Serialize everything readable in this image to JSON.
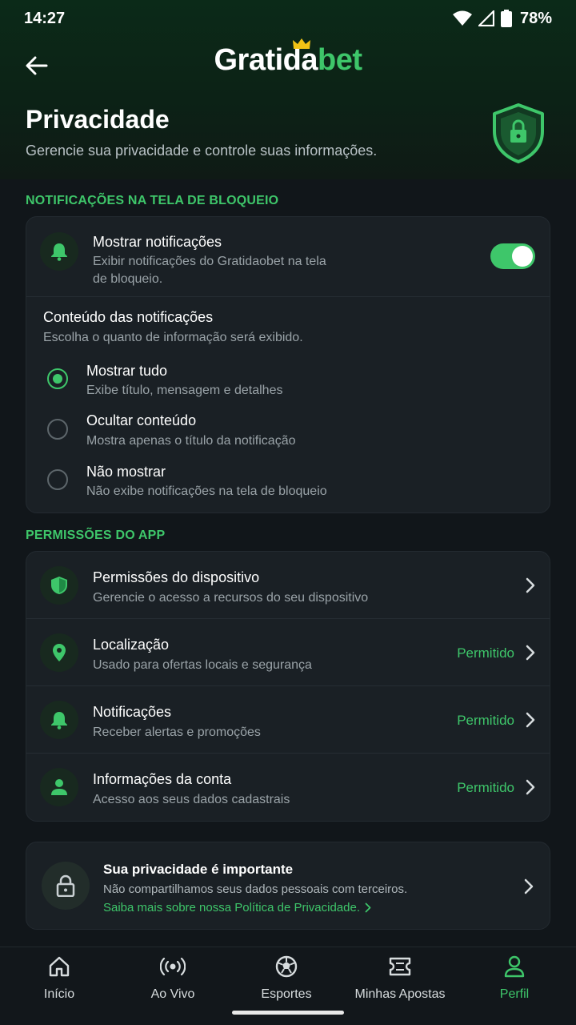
{
  "status_bar": {
    "time": "14:27",
    "battery": "78%"
  },
  "app": {
    "logo_white": "Gratida",
    "logo_green": "bet",
    "page_title": "Privacidade",
    "page_subtitle": "Gerencie sua privacidade e controle suas informações."
  },
  "lock_screen": {
    "section_label": "NOTIFICAÇÕES NA TELA DE BLOQUEIO",
    "show_notifications": {
      "title": "Mostrar notificações",
      "subtitle_line1": "Exibir notificações do Gratidaobet na tela",
      "subtitle_line2": "de bloqueio.",
      "enabled": true
    },
    "content": {
      "title": "Conteúdo das notificações",
      "subtitle": "Escolha o quanto de informação será exibido.",
      "options": [
        {
          "title": "Mostrar tudo",
          "subtitle": "Exibe título, mensagem e detalhes",
          "selected": true
        },
        {
          "title": "Ocultar conteúdo",
          "subtitle": "Mostra apenas o título da notificação",
          "selected": false
        },
        {
          "title": "Não mostrar",
          "subtitle": "Não exibe notificações na tela de bloqueio",
          "selected": false
        }
      ]
    }
  },
  "permissions": {
    "section_label": "PERMISSÕES DO APP",
    "items": [
      {
        "icon": "shield-check-icon",
        "title": "Permissões do dispositivo",
        "subtitle": "Gerencie o acesso a recursos do seu dispositivo",
        "status": ""
      },
      {
        "icon": "location-pin-icon",
        "title": "Localização",
        "subtitle": "Usado para ofertas locais e segurança",
        "status": "Permitido"
      },
      {
        "icon": "bell-icon",
        "title": "Notificações",
        "subtitle": "Receber alertas e promoções",
        "status": "Permitido"
      },
      {
        "icon": "person-icon",
        "title": "Informações da conta",
        "subtitle": "Acesso aos seus dados cadastrais",
        "status": "Permitido"
      }
    ]
  },
  "privacy_card": {
    "title": "Sua privacidade é importante",
    "subtitle": "Não compartilhamos seus dados pessoais com terceiros.",
    "link": "Saiba mais sobre nossa Política de Privacidade."
  },
  "bottom_nav": {
    "items": [
      {
        "label": "Início",
        "icon": "home-icon",
        "active": false
      },
      {
        "label": "Ao Vivo",
        "icon": "live-broadcast-icon",
        "active": false
      },
      {
        "label": "Esportes",
        "icon": "soccer-ball-icon",
        "active": false
      },
      {
        "label": "Minhas Apostas",
        "icon": "ticket-icon",
        "active": false
      },
      {
        "label": "Perfil",
        "icon": "profile-icon",
        "active": true
      }
    ]
  },
  "colors": {
    "accent": "#3ec66a",
    "background": "#11161a",
    "card": "#1a2025"
  }
}
